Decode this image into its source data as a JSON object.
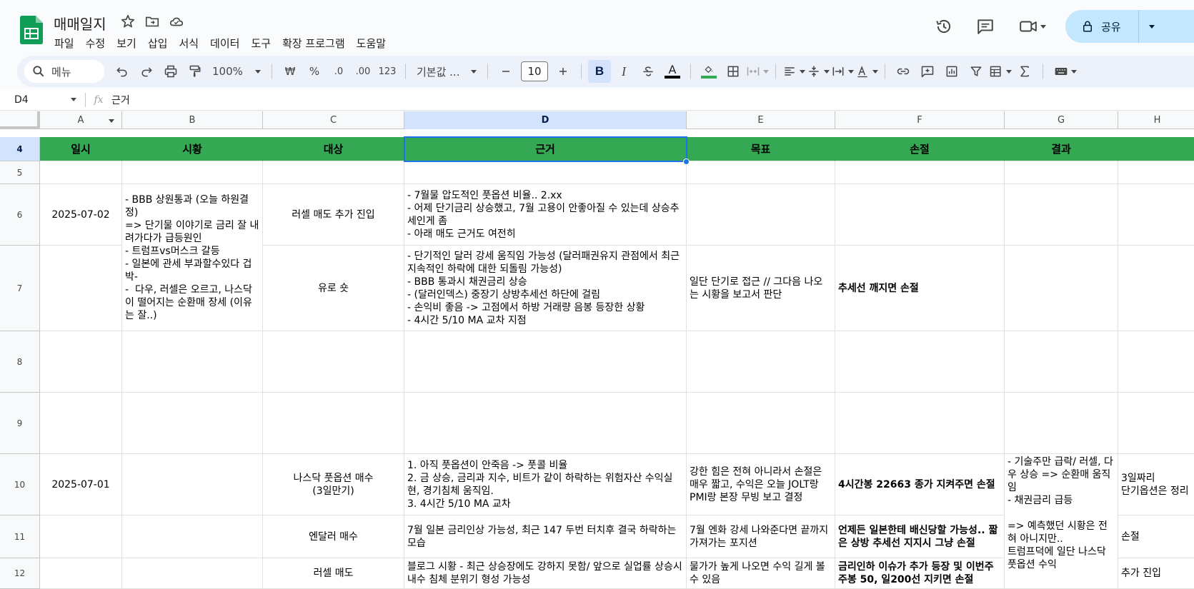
{
  "app": {
    "doc_title": "매매일지",
    "menu": [
      "파일",
      "수정",
      "보기",
      "삽입",
      "서식",
      "데이터",
      "도구",
      "확장 프로그램",
      "도움말"
    ],
    "share_label": "공유"
  },
  "toolbar": {
    "menu_search": "메뉴",
    "zoom": "100%",
    "currency": "₩",
    "percent": "%",
    "dec_decrease": ".0",
    "dec_increase": ".00",
    "number_format": "123",
    "font": "기본값 ...",
    "font_size": "10",
    "bold": "B",
    "italic": "I",
    "text_color": "A"
  },
  "formula_bar": {
    "cell_ref": "D4",
    "fx": "fx",
    "value": "근거"
  },
  "columns": [
    "A",
    "B",
    "C",
    "D",
    "E",
    "F",
    "G",
    "H"
  ],
  "rows": [
    "4",
    "5",
    "6",
    "7",
    "8",
    "9",
    "10",
    "11",
    "12"
  ],
  "header_row": [
    "일시",
    "시황",
    "대상",
    "근거",
    "목표",
    "손절",
    "결과",
    ""
  ],
  "cells": {
    "a6": "2025-07-02",
    "b6": "- BBB 상원통과 (오늘 하원결정)\n=> 단기물 이야기로 금리 잘 내려가다가 급등원인\n- 트럼프vs머스크 갈등\n- 일본에 관세 부과할수있다 겁박-\n-  다우, 러셀은 오르고, 나스닥이 떨어지는 순환매 장세 (이유는 잘..)",
    "c6": "러셀 매도 추가 진입",
    "d6": "- 7월물 압도적인 풋옵션 비율.. 2.xx\n- 어제 단기금리 상승했고, 7월 고용이 안좋아질 수 있는데 상승추세인게 좀\n- 아래 매도 근거도 여전히",
    "c7": "유로 숏",
    "d7": "- 단기적인 달러 강세 움직임 가능성 (달러패권유지 관점에서 최근지속적인 하락에 대한 되돌림 가능성)\n- BBB 통과시 채권금리 상승\n- (달러인덱스) 중장기 상방추세선 하단에 걸림\n- 손익비 좋음 -> 고점에서 하방 거래량 음봉 등장한 상황\n- 4시간 5/10 MA 교차 지점",
    "e7": "일단 단기로 접근 // 그다음 나오는 시황을 보고서 판단",
    "f7": "추세선 깨지면 손절",
    "a10": "2025-07-01",
    "c10": "나스닥 풋옵션 매수\n(3일만기)",
    "d10": "1. 아직 풋옵션이 안죽음 -> 풋콜 비율\n2. 금 상승, 금리과 지수, 비트가 같이 하락하는 위험자산 수익실현, 경기침체 움직임.\n3. 4시간 5/10 MA 교차",
    "e10": "강한 힘은 전혀 아니라서 손절은 매우 짧고, 수익은 오늘 JOLT랑 PMI랑 본장 무빙 보고 결정",
    "f10": "4시간봉 22663 종가 지켜주면 손절",
    "g10": "- 기술주만 급락/ 러셀, 다우 상승 => 순환매 움직임\n- 채권금리 급등\n\n=> 예측했던 시황은 전혀 아니지만..\n트럼프덕에 일단 나스닥 풋옵션 수익",
    "h10": "3일짜리\n단기옵션은 정리",
    "c11": "엔달러 매수",
    "d11": "7월 일본 금리인상 가능성, 최근 147 두번 터치후 결국 하락하는 모습",
    "e11": "7월 엔화 강세 나와준다면 끝까지 가져가는 포지션",
    "f11": "언제든 일본한테 배신당할 가능성.. 짧은 상방 추세선 지지시 그냥 손절",
    "h11": "손절",
    "c12": "러셀 매도",
    "d12": "블로그 시황 - 최근 상승장에도 강하지 못함/ 앞으로 실업률 상승시 내수 침체 분위기 형성 가능성",
    "e12": "물가가 높게 나오면 수익 길게 볼 수 있음",
    "f12": "금리인하 이슈가 추가 등장 및 이번주 주봉 50, 일200선 지키면 손절",
    "h12": "추가 진입"
  },
  "colors": {
    "header_green": "#34a853",
    "selection_blue": "#1a73e8",
    "selected_header": "#d3e3fd"
  }
}
